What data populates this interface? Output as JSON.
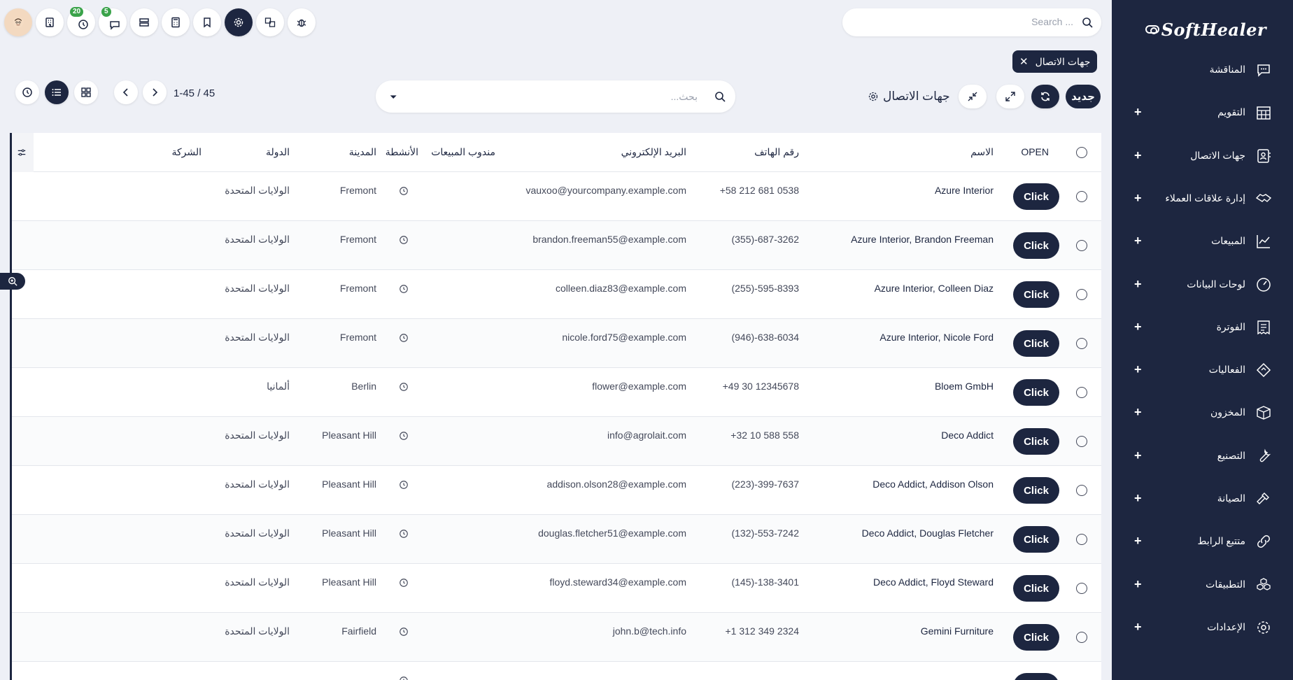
{
  "sidebar": {
    "logo": "SoftHealer",
    "items": [
      {
        "label": "المناقشة",
        "icon": "chat-icon",
        "plus": false
      },
      {
        "label": "التقويم",
        "icon": "calendar-icon",
        "plus": true
      },
      {
        "label": "جهات الاتصال",
        "icon": "contacts-icon",
        "plus": true
      },
      {
        "label": "إدارة علاقات العملاء",
        "icon": "handshake-icon",
        "plus": true
      },
      {
        "label": "المبيعات",
        "icon": "chart-line-icon",
        "plus": true
      },
      {
        "label": "لوحات البيانات",
        "icon": "dashboard-gauge-icon",
        "plus": true
      },
      {
        "label": "الفوترة",
        "icon": "invoice-icon",
        "plus": true
      },
      {
        "label": "الفعاليات",
        "icon": "ticket-icon",
        "plus": true
      },
      {
        "label": "المخزون",
        "icon": "box-icon",
        "plus": true
      },
      {
        "label": "التصنيع",
        "icon": "wrench-icon",
        "plus": true
      },
      {
        "label": "الصيانة",
        "icon": "hammer-icon",
        "plus": true
      },
      {
        "label": "متتبع الرابط",
        "icon": "link-icon",
        "plus": true
      },
      {
        "label": "التطبيقات",
        "icon": "apps-cubes-icon",
        "plus": true
      },
      {
        "label": "الإعدادات",
        "icon": "gear-icon",
        "plus": true
      }
    ]
  },
  "topbar": {
    "search_placeholder": "Search ...",
    "badges": {
      "activities": "20",
      "messages": "5"
    }
  },
  "breadcrumb": {
    "label": "جهات الاتصال"
  },
  "control": {
    "new_label": "جديد",
    "view_title": "جهات الاتصال",
    "search_placeholder": "بحث...",
    "pager": "1-45 / 45"
  },
  "table": {
    "headers": {
      "open": "OPEN",
      "name": "الاسم",
      "phone": "رقم الهاتف",
      "email": "البريد الإلكتروني",
      "salesperson": "مندوب المبيعات",
      "activities": "الأنشطة",
      "city": "المدينة",
      "country": "الدولة",
      "company": "الشركة"
    },
    "click_label": "Click",
    "rows": [
      {
        "name": "Azure Interior",
        "phone": "+58 212 681 0538",
        "email": "vauxoo@yourcompany.example.com",
        "city": "Fremont",
        "country": "الولايات المتحدة"
      },
      {
        "name": "Azure Interior, Brandon Freeman",
        "phone": "(355)-687-3262",
        "email": "brandon.freeman55@example.com",
        "city": "Fremont",
        "country": "الولايات المتحدة"
      },
      {
        "name": "Azure Interior, Colleen Diaz",
        "phone": "(255)-595-8393",
        "email": "colleen.diaz83@example.com",
        "city": "Fremont",
        "country": "الولايات المتحدة"
      },
      {
        "name": "Azure Interior, Nicole Ford",
        "phone": "(946)-638-6034",
        "email": "nicole.ford75@example.com",
        "city": "Fremont",
        "country": "الولايات المتحدة"
      },
      {
        "name": "Bloem GmbH",
        "phone": "+49 30 12345678",
        "email": "flower@example.com",
        "city": "Berlin",
        "country": "ألمانيا"
      },
      {
        "name": "Deco Addict",
        "phone": "+32 10 588 558",
        "email": "info@agrolait.com",
        "city": "Pleasant Hill",
        "country": "الولايات المتحدة"
      },
      {
        "name": "Deco Addict, Addison Olson",
        "phone": "(223)-399-7637",
        "email": "addison.olson28@example.com",
        "city": "Pleasant Hill",
        "country": "الولايات المتحدة"
      },
      {
        "name": "Deco Addict, Douglas Fletcher",
        "phone": "(132)-553-7242",
        "email": "douglas.fletcher51@example.com",
        "city": "Pleasant Hill",
        "country": "الولايات المتحدة"
      },
      {
        "name": "Deco Addict, Floyd Steward",
        "phone": "(145)-138-3401",
        "email": "floyd.steward34@example.com",
        "city": "Pleasant Hill",
        "country": "الولايات المتحدة"
      },
      {
        "name": "Gemini Furniture",
        "phone": "+1 312 349 2324",
        "email": "john.b@tech.info",
        "city": "Fairfield",
        "country": "الولايات المتحدة"
      },
      {
        "name": "",
        "phone": "",
        "email": "",
        "city": "",
        "country": ""
      }
    ]
  },
  "colors": {
    "navy": "#1d2640",
    "background": "#eef0f6",
    "badge_green": "#3aa34a"
  }
}
